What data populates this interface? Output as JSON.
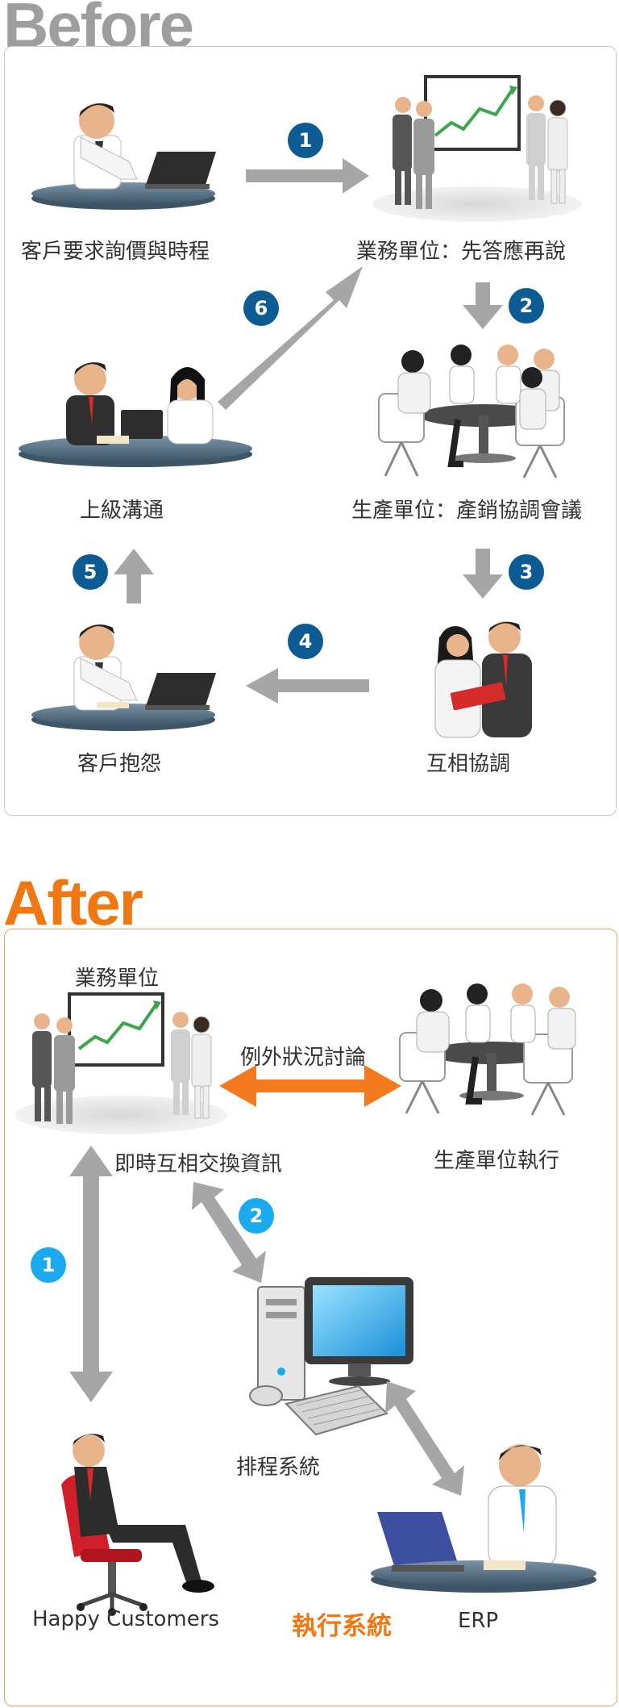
{
  "before": {
    "heading": "Before",
    "nodes": {
      "customer_request": "客戶要求詢價與時程",
      "sales": "業務單位：先答應再說",
      "production": "生產單位：產銷協調會議",
      "coordinate": "互相協調",
      "complaint": "客戶抱怨",
      "escalate": "上級溝通"
    },
    "steps": [
      "1",
      "2",
      "3",
      "4",
      "5",
      "6"
    ]
  },
  "after": {
    "heading": "After",
    "nodes": {
      "sales": "業務單位",
      "realtime": "即時互相交換資訊",
      "exception": "例外狀況討論",
      "production": "生產單位執行",
      "scheduling": "排程系統",
      "customers": "Happy Customers",
      "execution": "執行系統",
      "erp": "ERP"
    },
    "steps": [
      "1",
      "2"
    ]
  },
  "colors": {
    "step_badge_before": "#0d5b93",
    "step_badge_after": "#1ba9ef",
    "exception_arrow": "#f47a1f",
    "flow_arrow": "#a6a6a6",
    "before_heading": "#9e9e9e",
    "after_heading": "#f07813"
  },
  "icons": [
    "businessman-laptop-icon",
    "presentation-board-icon",
    "meeting-table-icon",
    "handshake-discussion-icon",
    "boss-meeting-icon",
    "desktop-computer-icon",
    "relaxed-customer-chair-icon",
    "erp-operator-icon"
  ]
}
